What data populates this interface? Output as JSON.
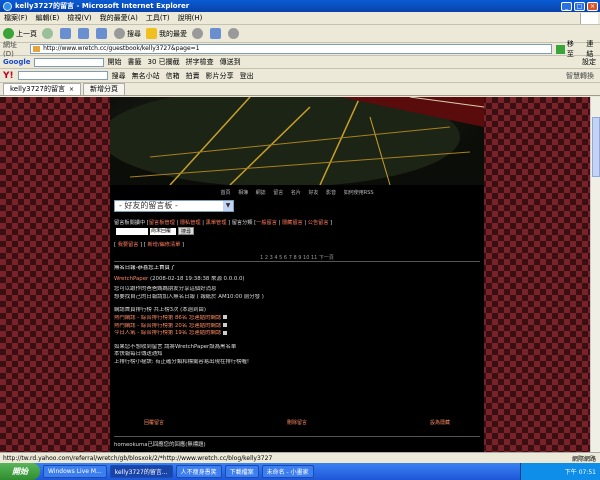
{
  "window": {
    "title": "kelly3727的留言 - Microsoft Internet Explorer",
    "controls": [
      "_",
      "□",
      "×"
    ]
  },
  "menu": [
    "檔案(F)",
    "編輯(E)",
    "檢視(V)",
    "我的最愛(A)",
    "工具(T)",
    "說明(H)"
  ],
  "toolbar": {
    "back": "上一頁",
    "search": "搜尋",
    "favorites": "我的最愛"
  },
  "address": {
    "label": "網址(D)",
    "url": "http://www.wretch.cc/guestbook/kelly3727&page=1",
    "go": "移至",
    "links": "連結"
  },
  "google": {
    "logo": "Google",
    "items": [
      "開始",
      "書籤",
      "30 已攔截",
      "拼字檢查",
      "傳送到"
    ],
    "right": "設定"
  },
  "yahoo": {
    "logo": "Y!",
    "items": [
      "搜尋",
      "無名小站",
      "信箱",
      "拍賣",
      "影片分享",
      "登出"
    ],
    "right": "智慧轉換"
  },
  "tabs": [
    {
      "label": "kelly3727的留言",
      "active": true
    },
    {
      "label": "新增分頁",
      "active": false
    }
  ],
  "site": {
    "nav": [
      "首頁",
      "相簿",
      "網誌",
      "留言",
      "名片",
      "好友",
      "影音",
      "如何使用RSS"
    ],
    "board_select": "- 好友的留言板 -",
    "category_line_prefix": "留言板閱讀中 [",
    "categories": [
      "留言板管理",
      "隱私管理",
      "黑單管理",
      "一般留言",
      "隱藏留言",
      "公告留言"
    ],
    "category_line_label": " ] 留言分類 [",
    "search": {
      "select": "尚未回覆",
      "button": "搜尋"
    },
    "actions": [
      "我要留言",
      "新增/編修清單"
    ],
    "pager": "1 2 3 4 5 6 7 8 9 10 11 下一頁"
  },
  "post": {
    "title": "無名日報-恭喜您上首頁了",
    "author_link": "WretchPaper",
    "meta": "(2008-02-18 19:38:38 來源 0.0.0.0)",
    "lines": [
      "您可以跟作的爸爸媽媽朋友分享這個好消息",
      "想要找自己的日報請加入無名日報 ( 報紙於 AM10:00 前分發 )",
      "網誌首頁排行榜 共上榜3次 (本週到由)",
      "熱門網誌 - 綜合排行榜第 86名 您連結的網誌",
      "熱門網誌 - 綜合排行榜第 20名 您連結的網誌",
      "今日人氣 - 綜合排行榜第 19名 您連結的網誌",
      "如果您不想收到留言 請將WretchPaper設為黑名單",
      "本快報每日傳送通知",
      "上排行榜小秘訣: 有正確分類和標籤容易出現在排行榜喔!"
    ],
    "footer": [
      "回覆留言",
      "刪除留言",
      "設為隱藏"
    ]
  },
  "next_post_title": "homeokuma已回應您的回應(無標題)",
  "statusbar": {
    "url": "http://tw.rd.yahoo.com/referral/wretch/gb/blosxok/2/*http://www.wretch.cc/blog/kelly3727",
    "zone": "網際網路"
  },
  "taskbar": {
    "start": "開始",
    "tasks": [
      {
        "label": "Windows Live M...",
        "active": false
      },
      {
        "label": "kelly3727的留言...",
        "active": true
      },
      {
        "label": "人不瘦身愚笑",
        "active": false
      },
      {
        "label": "下載檔案",
        "active": false
      },
      {
        "label": "未命名 - 小畫家",
        "active": false
      }
    ],
    "clock": "下午 07:51"
  },
  "colors": {
    "xp_blue": "#0a5bd5",
    "page_bg": "#000000",
    "link": "#ff7a5a",
    "argyle_dark": "#3a0f12",
    "argyle_red": "#7a2229"
  }
}
